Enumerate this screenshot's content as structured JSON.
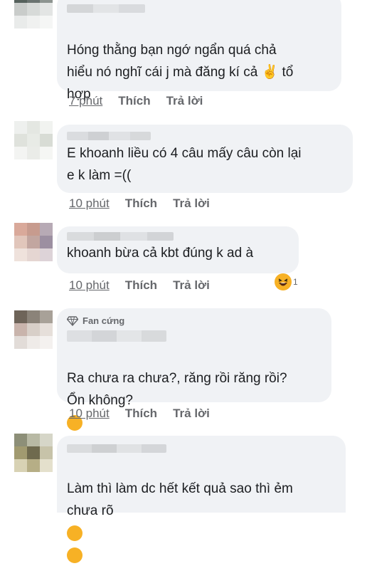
{
  "comments": [
    {
      "text": "Hóng thằng bạn ngớ ngẩn quá  chả\nhiểu nó nghĩ cái j mà đăng kí cả ✌️ tổ\nhợp",
      "time": "7 phút",
      "like": "Thích",
      "reply": "Trả lời"
    },
    {
      "text": "E khoanh liều có 4 câu mấy câu còn lại\ne k làm =((",
      "time": "10 phút",
      "like": "Thích",
      "reply": "Trả lời"
    },
    {
      "text": "khoanh bừa cả kbt đúng k ad à",
      "time": "10 phút",
      "like": "Thích",
      "reply": "Trả lời",
      "reaction_count": "1"
    },
    {
      "badge": "Fan cứng",
      "text": "Ra chưa ra chưa?, răng rồi răng rồi?\nỔn không?",
      "time": "10 phút",
      "like": "Thích",
      "reply": "Trả lời"
    },
    {
      "text": "Làm thì làm dc hết kết quả sao thì ẻm\nchưa rõ",
      "time": "",
      "like": "",
      "reply": ""
    }
  ],
  "colors": {
    "bubble_bg": "#f0f2f5",
    "meta_text": "#65676b",
    "emoji_yellow": "#f7b125"
  }
}
